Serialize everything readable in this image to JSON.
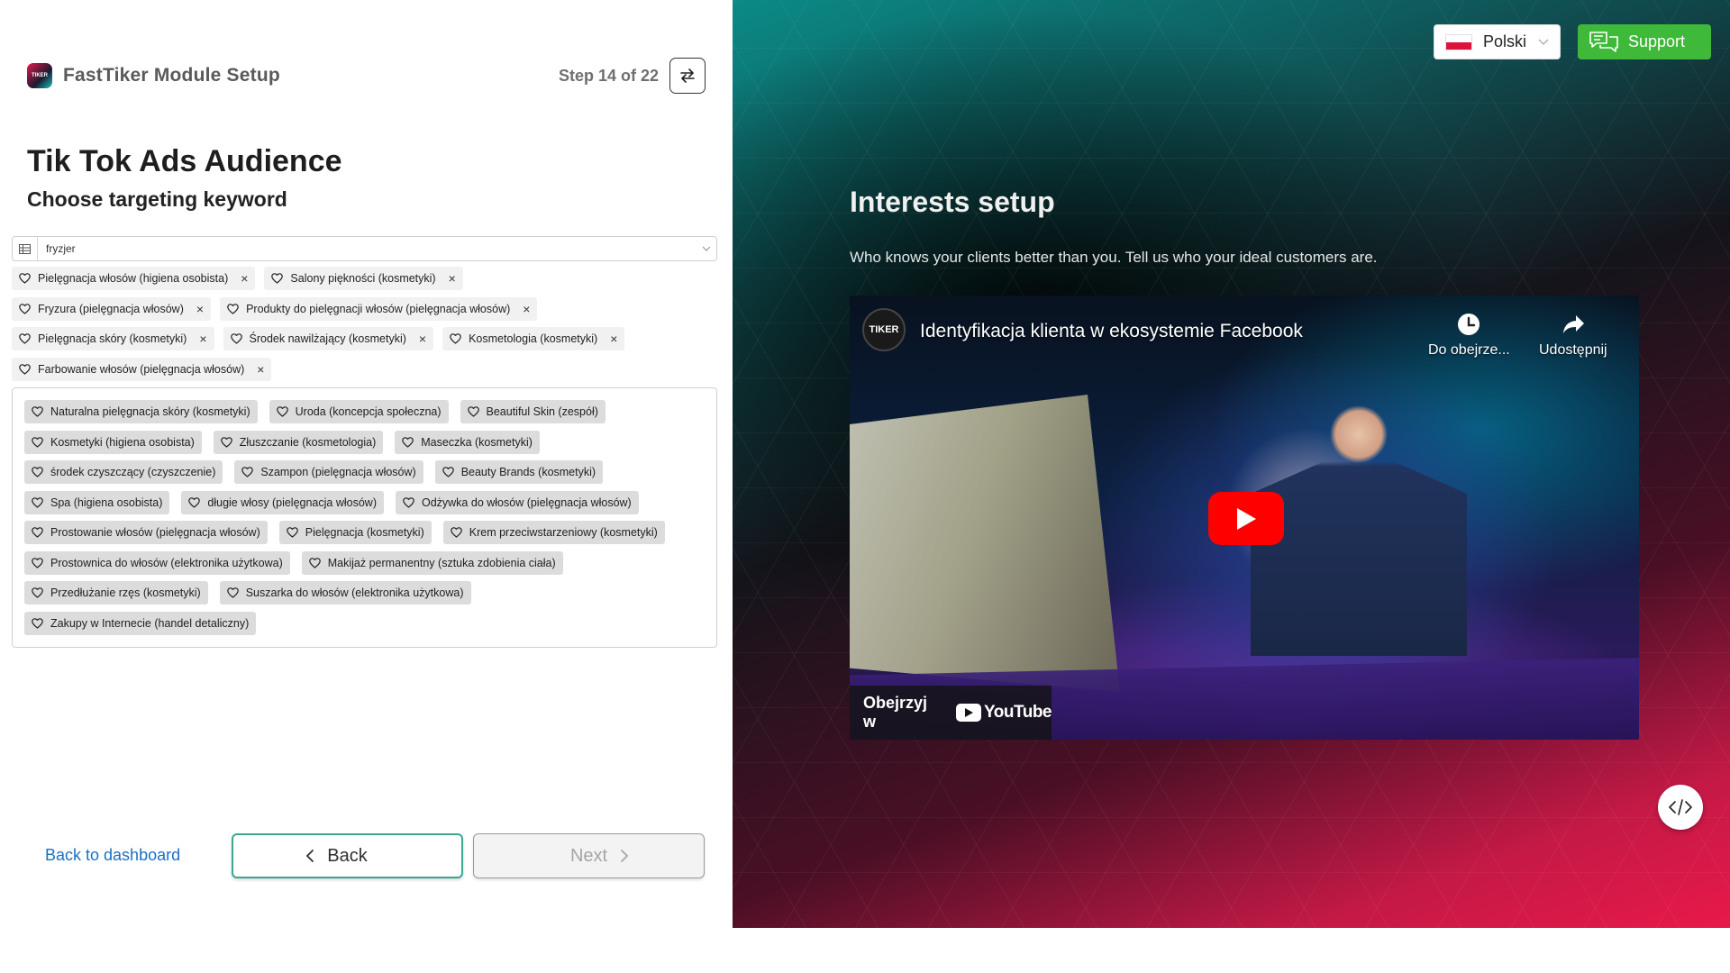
{
  "header": {
    "logo_text": "TIKER",
    "app_title": "FastTiker Module Setup",
    "step": "Step 14 of 22"
  },
  "main": {
    "title": "Tik Tok Ads Audience",
    "subtitle": "Choose targeting keyword",
    "search_value": "fryzjer",
    "selected": [
      [
        "Pielęgnacja włosów (higiena osobista)",
        "Salony piękności (kosmetyki)"
      ],
      [
        "Fryzura (pielęgnacja włosów)",
        "Produkty do pielęgnacji włosów (pielęgnacja włosów)"
      ],
      [
        "Pielęgnacja skóry (kosmetyki)",
        "Środek nawilżający (kosmetyki)",
        "Kosmetologia (kosmetyki)"
      ],
      [
        "Farbowanie włosów (pielęgnacja włosów)"
      ]
    ],
    "suggestions": [
      [
        "Naturalna pielęgnacja skóry (kosmetyki)",
        "Uroda (koncepcja społeczna)",
        "Beautiful Skin (zespół)"
      ],
      [
        "Kosmetyki (higiena osobista)",
        "Złuszczanie (kosmetologia)",
        "Maseczka (kosmetyki)"
      ],
      [
        "środek czyszczący (czyszczenie)",
        "Szampon (pielęgnacja włosów)",
        "Beauty Brands (kosmetyki)"
      ],
      [
        "Spa (higiena osobista)",
        "długie włosy (pielęgnacja włosów)",
        "Odżywka do włosów (pielęgnacja włosów)"
      ],
      [
        "Prostowanie włosów (pielęgnacja włosów)",
        "Pielęgnacja (kosmetyki)",
        "Krem przeciwstarzeniowy (kosmetyki)"
      ],
      [
        "Prostownica do włosów (elektronika użytkowa)",
        "Makijaż permanentny (sztuka zdobienia ciała)"
      ],
      [
        "Przedłużanie rzęs (kosmetyki)",
        "Suszarka do włosów (elektronika użytkowa)"
      ],
      [
        "Zakupy w Internecie (handel detaliczny)"
      ]
    ]
  },
  "footer": {
    "back_to_dashboard": "Back to dashboard",
    "back": "Back",
    "next": "Next"
  },
  "right": {
    "language": "Polski",
    "support": "Support",
    "title": "Interests setup",
    "description": "Who knows your clients better than you. Tell us who your ideal customers are.",
    "video": {
      "channel_logo": "TIKER",
      "title": "Identyfikacja klienta w ekosystemie Facebook",
      "watch_later": "Do obejrze...",
      "share": "Udostępnij",
      "watch_on": "Obejrzyj w",
      "youtube": "YouTube"
    }
  },
  "colors": {
    "accent_green": "#3fb93a",
    "back_border": "#3aa891",
    "link_blue": "#1d6fc4",
    "youtube_red": "#ff0000"
  },
  "icons": [
    "switch-icon",
    "grid-icon",
    "chevron-down-icon",
    "heart-icon",
    "close-icon",
    "chevron-left-icon",
    "chevron-right-icon",
    "chat-icon",
    "clock-icon",
    "share-icon",
    "play-icon",
    "code-icon"
  ]
}
